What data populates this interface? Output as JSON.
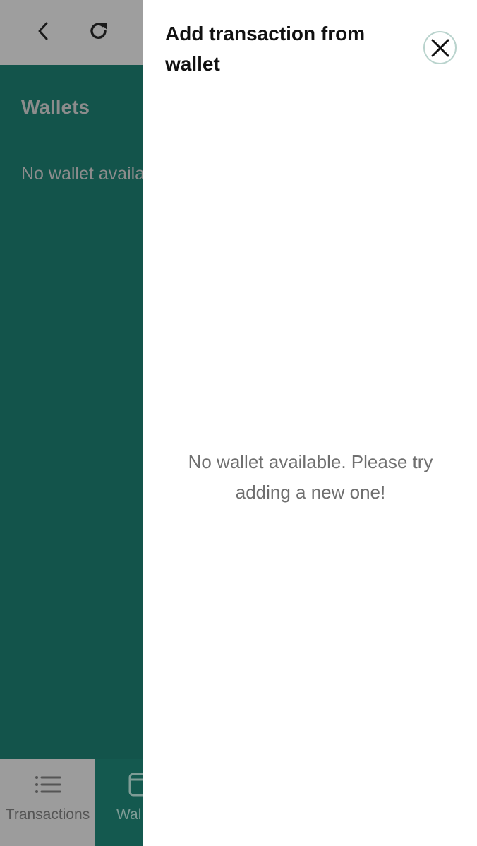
{
  "app": {
    "topbar": {
      "back_icon": "chevron-left-icon",
      "refresh_icon": "refresh-icon"
    },
    "main": {
      "title": "Wallets",
      "empty_text": "No wallet availa"
    },
    "bottom_nav": {
      "items": [
        {
          "label": "Transactions",
          "icon": "list-icon"
        },
        {
          "label": "Wal",
          "icon": "wallet-icon"
        }
      ]
    },
    "colors": {
      "topbar_bg": "#9e9e9e",
      "main_bg": "#13544b",
      "nav_bg": "#9c9c9c",
      "nav_active_bg": "#14594f"
    }
  },
  "drawer": {
    "title": "Add transaction from wallet",
    "close_icon": "close-icon",
    "empty_text": "No wallet available. Please try adding a new one!"
  }
}
